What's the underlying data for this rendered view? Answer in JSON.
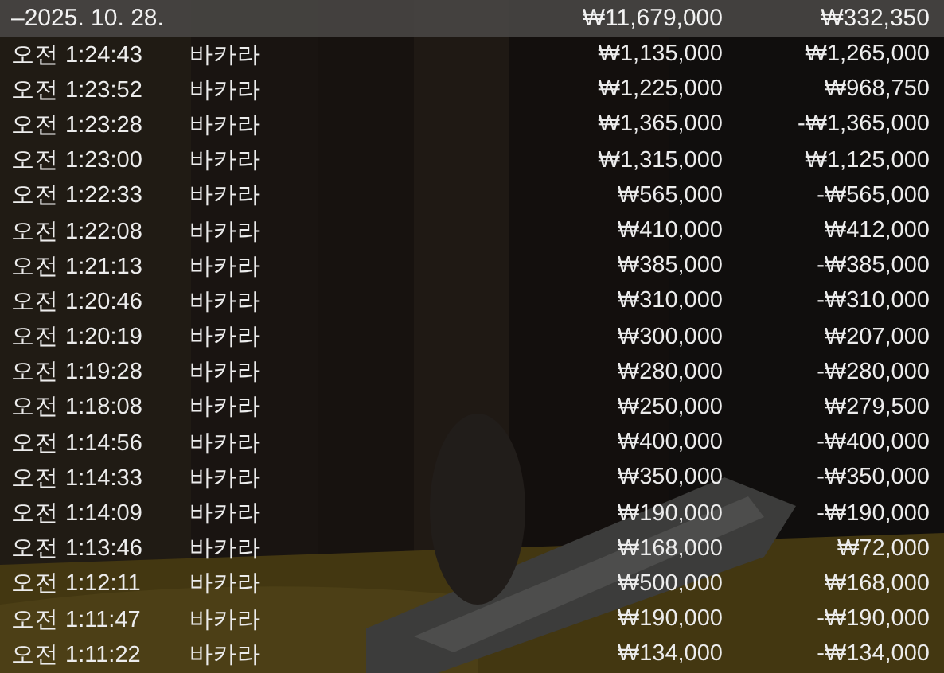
{
  "summary": {
    "date": "–2025. 10. 28.",
    "bet": "₩11,679,000",
    "result": "₩332,350"
  },
  "rows": [
    {
      "time": "오전 1:24:43",
      "game": "바카라",
      "bet": "₩1,135,000",
      "result": "₩1,265,000"
    },
    {
      "time": "오전 1:23:52",
      "game": "바카라",
      "bet": "₩1,225,000",
      "result": "₩968,750"
    },
    {
      "time": "오전 1:23:28",
      "game": "바카라",
      "bet": "₩1,365,000",
      "result": "-₩1,365,000"
    },
    {
      "time": "오전 1:23:00",
      "game": "바카라",
      "bet": "₩1,315,000",
      "result": "₩1,125,000"
    },
    {
      "time": "오전 1:22:33",
      "game": "바카라",
      "bet": "₩565,000",
      "result": "-₩565,000"
    },
    {
      "time": "오전 1:22:08",
      "game": "바카라",
      "bet": "₩410,000",
      "result": "₩412,000"
    },
    {
      "time": "오전 1:21:13",
      "game": "바카라",
      "bet": "₩385,000",
      "result": "-₩385,000"
    },
    {
      "time": "오전 1:20:46",
      "game": "바카라",
      "bet": "₩310,000",
      "result": "-₩310,000"
    },
    {
      "time": "오전 1:20:19",
      "game": "바카라",
      "bet": "₩300,000",
      "result": "₩207,000"
    },
    {
      "time": "오전 1:19:28",
      "game": "바카라",
      "bet": "₩280,000",
      "result": "-₩280,000"
    },
    {
      "time": "오전 1:18:08",
      "game": "바카라",
      "bet": "₩250,000",
      "result": "₩279,500"
    },
    {
      "time": "오전 1:14:56",
      "game": "바카라",
      "bet": "₩400,000",
      "result": "-₩400,000"
    },
    {
      "time": "오전 1:14:33",
      "game": "바카라",
      "bet": "₩350,000",
      "result": "-₩350,000"
    },
    {
      "time": "오전 1:14:09",
      "game": "바카라",
      "bet": "₩190,000",
      "result": "-₩190,000"
    },
    {
      "time": "오전 1:13:46",
      "game": "바카라",
      "bet": "₩168,000",
      "result": "₩72,000"
    },
    {
      "time": "오전 1:12:11",
      "game": "바카라",
      "bet": "₩500,000",
      "result": "₩168,000"
    },
    {
      "time": "오전 1:11:47",
      "game": "바카라",
      "bet": "₩190,000",
      "result": "-₩190,000"
    },
    {
      "time": "오전 1:11:22",
      "game": "바카라",
      "bet": "₩134,000",
      "result": "-₩134,000"
    }
  ]
}
